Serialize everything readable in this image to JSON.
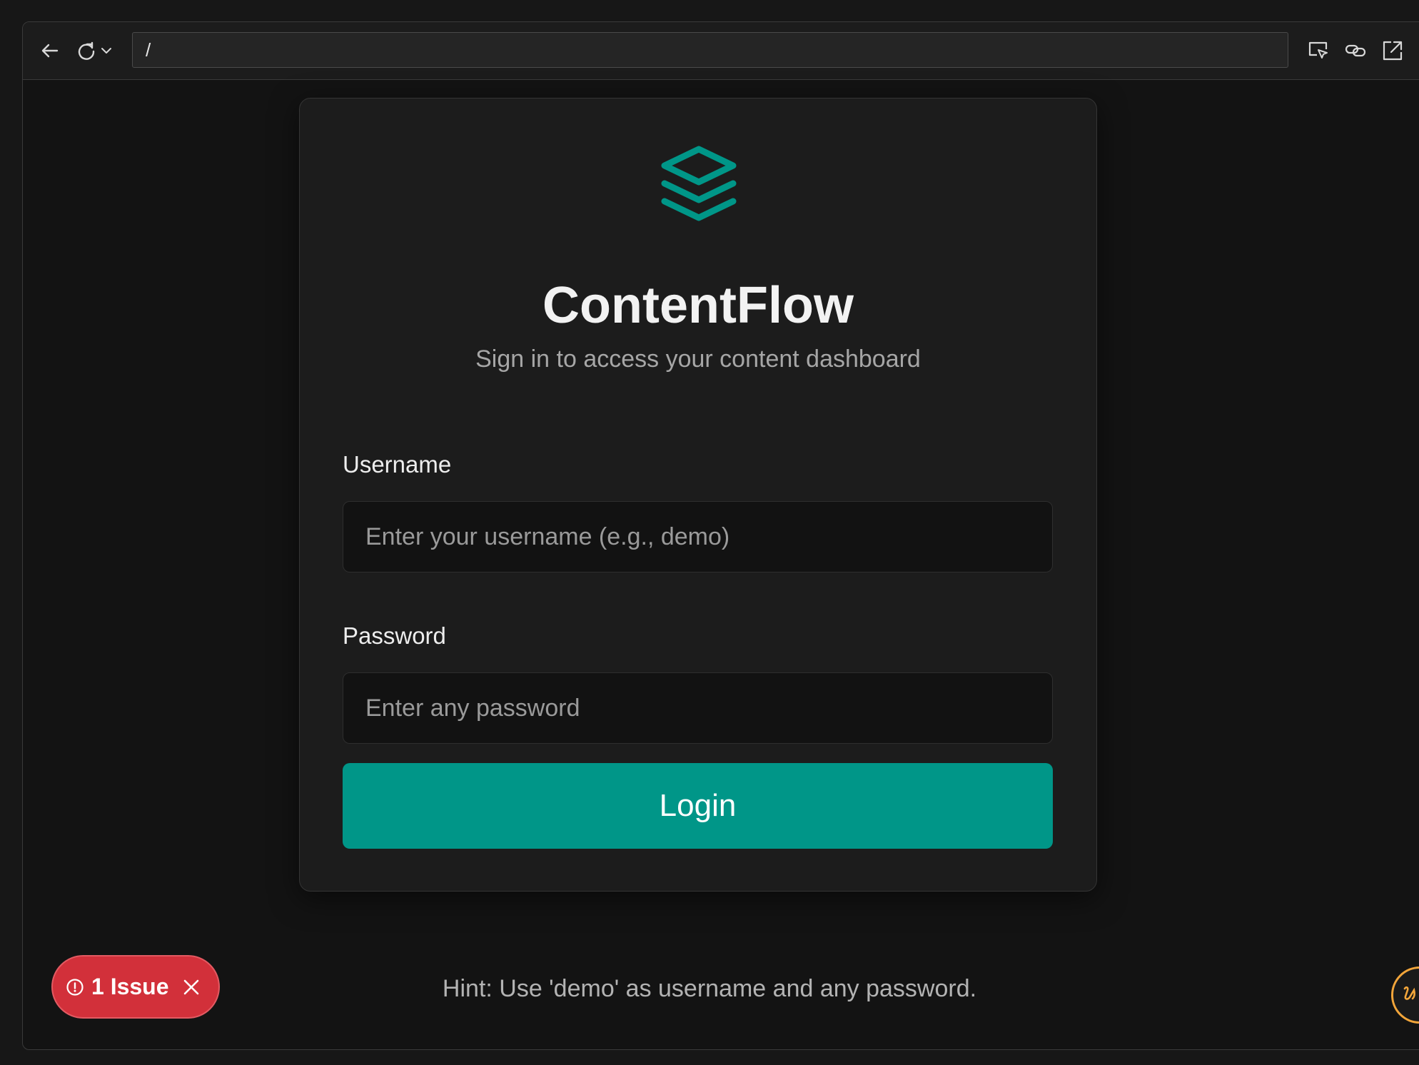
{
  "browser": {
    "address": "/",
    "icons": [
      "back-arrow-icon",
      "reload-icon",
      "chevron-down-icon",
      "inspect-icon",
      "link-icon",
      "open-external-icon"
    ]
  },
  "app": {
    "name": "ContentFlow",
    "subtitle": "Sign in to access your content dashboard",
    "logo_icon": "layers-stack-icon",
    "accent_color": "#009688"
  },
  "form": {
    "username": {
      "label": "Username",
      "placeholder": "Enter your username (e.g., demo)",
      "value": ""
    },
    "password": {
      "label": "Password",
      "placeholder": "Enter any password",
      "value": ""
    },
    "submit_label": "Login"
  },
  "hint": "Hint: Use 'demo' as username and any password.",
  "issues": {
    "label": "1 Issue",
    "color": "#d2303a"
  }
}
